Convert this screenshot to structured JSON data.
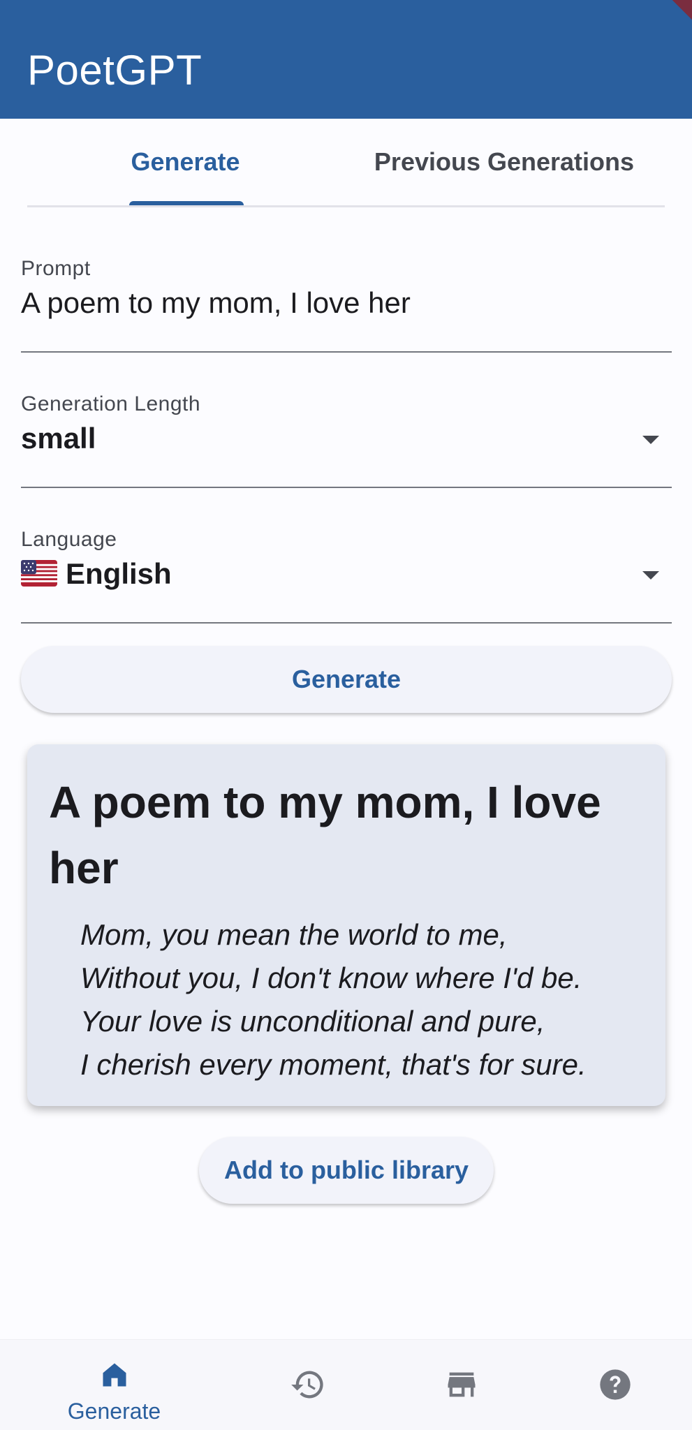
{
  "app": {
    "title": "PoetGPT"
  },
  "tabs": [
    {
      "label": "Generate",
      "active": true
    },
    {
      "label": "Previous Generations",
      "active": false
    }
  ],
  "form": {
    "prompt": {
      "label": "Prompt",
      "value": "A poem to my mom, I love her"
    },
    "length": {
      "label": "Generation Length",
      "value": "small"
    },
    "language": {
      "label": "Language",
      "value": "English",
      "flag_icon": "us-flag-icon"
    },
    "generate_label": "Generate"
  },
  "result": {
    "title": "A poem to my mom, I love her",
    "lines": [
      "Mom, you mean the world to me,",
      "Without you, I don't know where I'd be.",
      "Your love is unconditional and pure,",
      "I cherish every moment, that's for sure."
    ],
    "add_label": "Add to public library"
  },
  "bottom_nav": [
    {
      "icon": "home-icon",
      "label": "Generate",
      "active": true
    },
    {
      "icon": "history-icon",
      "label": "",
      "active": false
    },
    {
      "icon": "store-icon",
      "label": "",
      "active": false
    },
    {
      "icon": "help-icon",
      "label": "",
      "active": false
    }
  ],
  "colors": {
    "primary": "#2a5f9e",
    "background": "#fcfcff",
    "card": "#e4e8f2",
    "nav_inactive": "#74777f"
  }
}
